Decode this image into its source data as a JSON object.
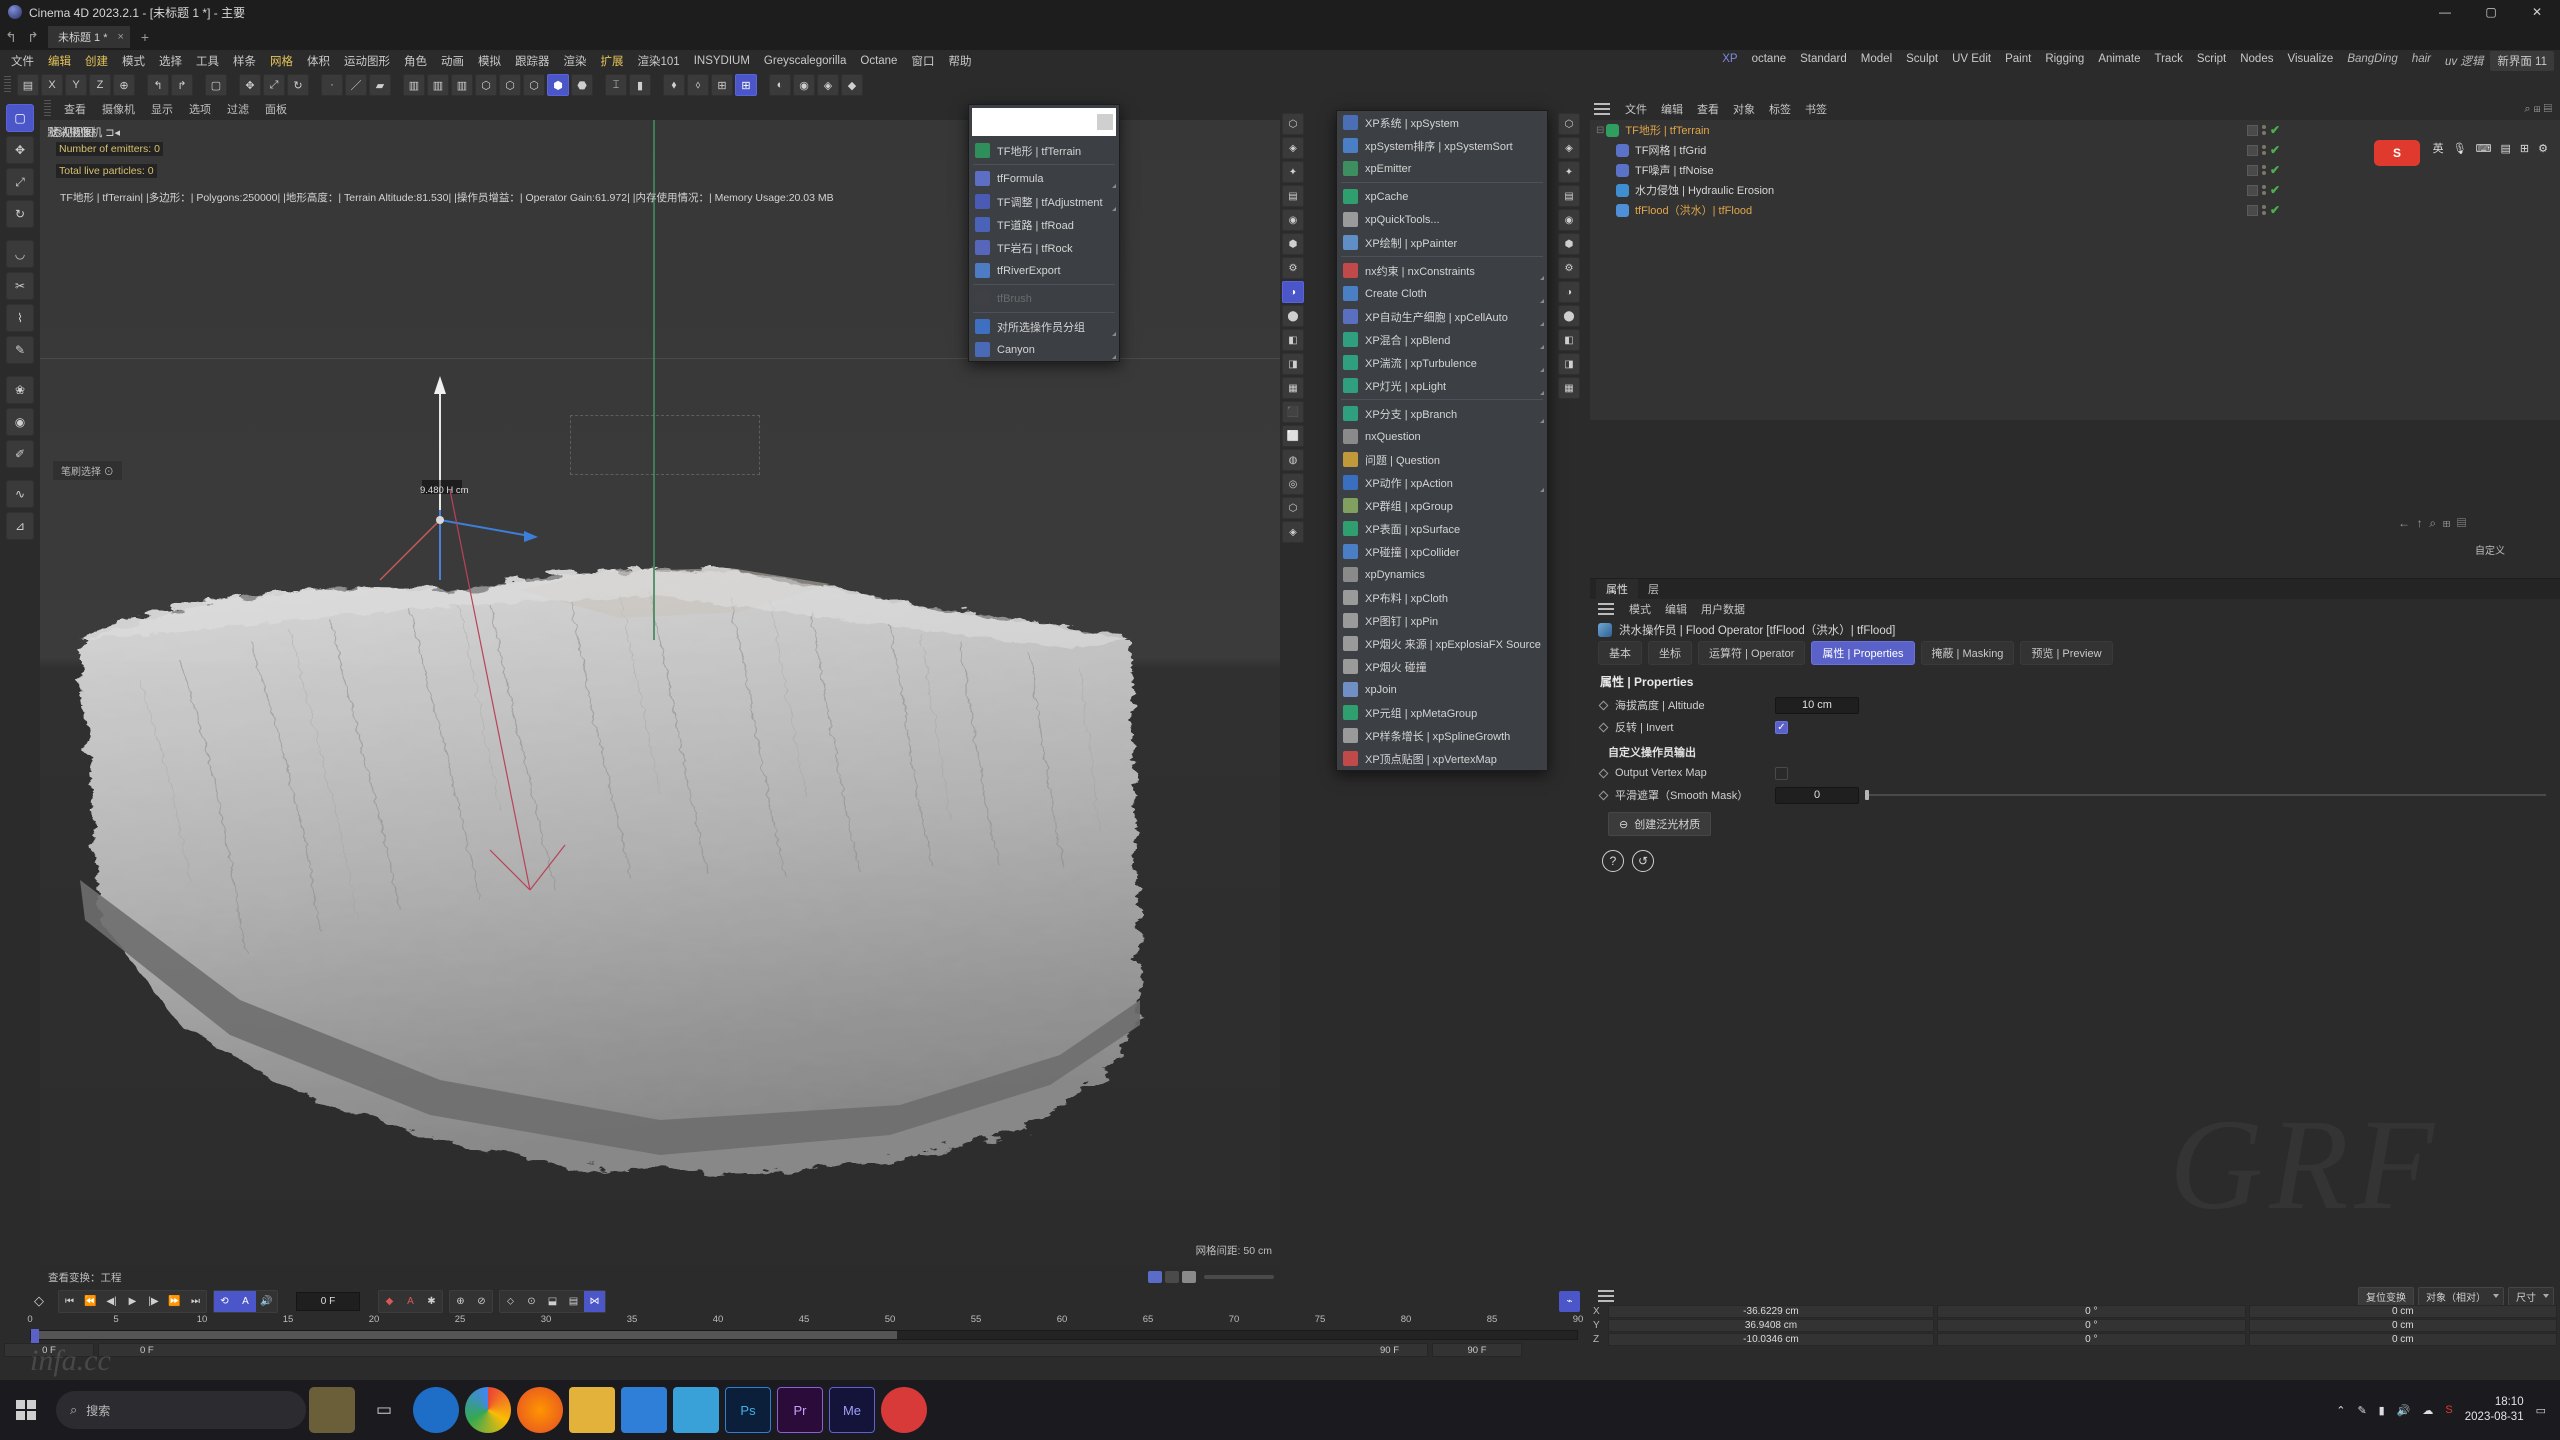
{
  "titlebar": {
    "title": "Cinema 4D 2023.2.1 - [未标题 1 *] - 主要",
    "minimize": "—",
    "maximize": "▢",
    "close": "✕"
  },
  "tabrow": {
    "undo": "↰",
    "redo": "↱",
    "doc_tab": "未标题 1 *",
    "close_tab": "×",
    "add_tab": "+"
  },
  "menubar": {
    "items": [
      "文件",
      "编辑",
      "创建",
      "模式",
      "选择",
      "工具",
      "样条",
      "网格",
      "体积",
      "运动图形",
      "角色",
      "动画",
      "模拟",
      "跟踪器",
      "渲染",
      "扩展",
      "渲染101",
      "INSYDIUM",
      "Greyscalegorilla",
      "Octane",
      "窗口",
      "帮助"
    ],
    "highlight": [
      "编辑",
      "创建",
      "网格",
      "扩展"
    ],
    "right_items": [
      "XP",
      "octane",
      "Standard",
      "Model",
      "Sculpt",
      "UV Edit",
      "Paint",
      "Rigging",
      "Animate",
      "Track",
      "Script",
      "Nodes",
      "Visualize",
      "BangDing",
      "hair",
      "uv 逻辑"
    ],
    "right_active": "XP",
    "right_italic": [
      "BangDing",
      "hair",
      "uv 逻辑"
    ],
    "new_layout": "新界面 11"
  },
  "toolbar": {
    "icons": [
      "grip",
      "move-lock",
      "x-axis",
      "y-axis",
      "z-axis",
      "world-coord",
      "sep",
      "undo-tool",
      "redo-tool",
      "sep",
      "live-select",
      "sep",
      "move",
      "scale",
      "rotate",
      "sep",
      "point-mode",
      "edge-mode",
      "poly-mode",
      "sep",
      "comb1",
      "comb2",
      "comb3",
      "snap1",
      "snap2",
      "snap3",
      "snap-on",
      "snap5",
      "sep",
      "workplane",
      "lock-wp",
      "sep",
      "deform1",
      "deform2",
      "quant1",
      "quant-on",
      "sep",
      "render1",
      "render2",
      "mat1",
      "mat2"
    ],
    "axis_labels": [
      "X",
      "Y",
      "Z"
    ]
  },
  "left_toolbar": {
    "items": [
      "live-selection-icon",
      "move-icon",
      "scale-icon",
      "rotate-icon",
      "sep",
      "magnet-icon",
      "knife-icon",
      "bridge-icon",
      "polygon-pen-icon",
      "sep",
      "brush-icon",
      "sculpt-icon",
      "paint-icon",
      "sep",
      "spline-pen-icon",
      "measure-icon"
    ]
  },
  "viewport": {
    "menu": [
      "查看",
      "摄像机",
      "显示",
      "选项",
      "过滤",
      "面板"
    ],
    "view_label": "透视视图",
    "camera_label": "默认摄像机",
    "emitters": "Number of emitters: 0",
    "particles": "Total live particles: 0",
    "statline": "TF地形 | tfTerrain| |多边形：| Polygons:250000| |地形高度：| Terrain Altitude:81.530| |操作员增益：| Operator Gain:61.972| |内存使用情况：| Memory Usage:20.03 MB",
    "brush_mode": "笔刷选择",
    "gizmo_label": "9.480 H cm",
    "grid_info": "网格间距: 50 cm",
    "footer_left": "查看变换：工程"
  },
  "dropdown_tf": {
    "search_placeholder": "",
    "items": [
      {
        "label": "TF地形 | tfTerrain",
        "color": "#2f8f5a",
        "sub": false,
        "disabled": false
      },
      {
        "label": "tfFormula",
        "color": "#5d6fc4",
        "sub": true,
        "disabled": false
      },
      {
        "label": "TF调整 | tfAdjustment",
        "color": "#4a5bb5",
        "sub": true,
        "disabled": false
      },
      {
        "label": "TF道路 | tfRoad",
        "color": "#4a62b8",
        "sub": false,
        "disabled": false
      },
      {
        "label": "TF岩石 | tfRock",
        "color": "#5566bb",
        "sub": false,
        "disabled": false
      },
      {
        "label": "tfRiverExport",
        "color": "#4d7cc4",
        "sub": false,
        "disabled": false
      },
      {
        "label": "tfBrush",
        "color": "#3e4044",
        "sub": false,
        "disabled": true
      },
      {
        "label": "对所选操作员分组",
        "color": "#3f6fc0",
        "sub": true,
        "disabled": false
      },
      {
        "label": "Canyon",
        "color": "#4a6ab8",
        "sub": true,
        "disabled": false
      }
    ]
  },
  "dropdown_xp": {
    "items": [
      {
        "label": "XP系统 | xpSystem",
        "color": "#4a6fb5",
        "sub": false,
        "sep_after": false
      },
      {
        "label": "xpSystem排序 | xpSystemSort",
        "color": "#4a7fc5",
        "sub": false,
        "sep_after": false
      },
      {
        "label": "xpEmitter",
        "color": "#3e8f5f",
        "sub": false,
        "sep_after": true
      },
      {
        "label": "xpCache",
        "color": "#2f9f6f",
        "sub": false,
        "sep_after": false
      },
      {
        "label": "xpQuickTools...",
        "color": "#9a9a9a",
        "sub": false,
        "sep_after": false
      },
      {
        "label": "XP绘制 | xpPainter",
        "color": "#5f8fc5",
        "sub": false,
        "sep_after": true
      },
      {
        "label": "nx约束 | nxConstraints",
        "color": "#c04a4a",
        "sub": true,
        "sep_after": false
      },
      {
        "label": "Create Cloth",
        "color": "#4a7fc5",
        "sub": true,
        "sep_after": false
      },
      {
        "label": "XP自动生产细胞 | xpCellAuto",
        "color": "#5a6fc0",
        "sub": true,
        "sep_after": false
      },
      {
        "label": "XP混合 | xpBlend",
        "color": "#2f9f7f",
        "sub": true,
        "sep_after": false
      },
      {
        "label": "XP湍流 | xpTurbulence",
        "color": "#2f9f7f",
        "sub": true,
        "sep_after": false
      },
      {
        "label": "XP灯光 | xpLight",
        "color": "#2f9f7f",
        "sub": true,
        "sep_after": true
      },
      {
        "label": "XP分支 | xpBranch",
        "color": "#2f9f7f",
        "sub": true,
        "sep_after": false
      },
      {
        "label": "nxQuestion",
        "color": "#8a8a8a",
        "sub": false,
        "sep_after": false
      },
      {
        "label": "问题 | Question",
        "color": "#c09a3a",
        "sub": false,
        "sep_after": false
      },
      {
        "label": "XP动作 | xpAction",
        "color": "#3a6fc0",
        "sub": true,
        "sep_after": false
      },
      {
        "label": "XP群组 | xpGroup",
        "color": "#7fa05f",
        "sub": false,
        "sep_after": false
      },
      {
        "label": "XP表面 | xpSurface",
        "color": "#2f9f6f",
        "sub": false,
        "sep_after": false
      },
      {
        "label": "XP碰撞 | xpCollider",
        "color": "#4a7fc5",
        "sub": false,
        "sep_after": false
      },
      {
        "label": "xpDynamics",
        "color": "#8a8a8a",
        "sub": false,
        "sep_after": false
      },
      {
        "label": "XP布料 | xpCloth",
        "color": "#9a9a9a",
        "sub": false,
        "sep_after": false
      },
      {
        "label": "XP图钉 | xpPin",
        "color": "#9a9a9a",
        "sub": false,
        "sep_after": false
      },
      {
        "label": "XP烟火 来源 | xpExplosiaFX Source",
        "color": "#9a9a9a",
        "sub": false,
        "sep_after": false
      },
      {
        "label": "XP烟火 碰撞",
        "color": "#9a9a9a",
        "sub": false,
        "sep_after": false
      },
      {
        "label": "xpJoin",
        "color": "#6f8fc5",
        "sub": false,
        "sep_after": false
      },
      {
        "label": "XP元组 | xpMetaGroup",
        "color": "#2f9f6f",
        "sub": false,
        "sep_after": false
      },
      {
        "label": "XP样条增长 | xpSplineGrowth",
        "color": "#9a9a9a",
        "sub": false,
        "sep_after": false
      },
      {
        "label": "XP顶点贴图 | xpVertexMap",
        "color": "#c04a4a",
        "sub": false,
        "sep_after": false
      }
    ]
  },
  "object_manager": {
    "menu": [
      "文件",
      "编辑",
      "查看",
      "对象",
      "标签",
      "书签"
    ],
    "rows": [
      {
        "label": "TF地形 | tfTerrain",
        "indent": 0,
        "selected": true,
        "color": "#2f9f5f",
        "expander": "⊟"
      },
      {
        "label": "TF网格 | tfGrid",
        "indent": 1,
        "selected": false,
        "color": "#5a72c8",
        "expander": ""
      },
      {
        "label": "TF噪声 | tfNoise",
        "indent": 1,
        "selected": false,
        "color": "#5a72c8",
        "expander": ""
      },
      {
        "label": "水力侵蚀 | Hydraulic Erosion",
        "indent": 1,
        "selected": false,
        "color": "#3f8fd0",
        "expander": ""
      },
      {
        "label": "tfFlood（洪水）| tfFlood",
        "indent": 1,
        "selected": true,
        "color": "#4f8fd8",
        "expander": ""
      }
    ]
  },
  "attributes": {
    "tabs": [
      "属性",
      "层"
    ],
    "active_tab": "属性",
    "menu": [
      "模式",
      "编辑",
      "用户数据"
    ],
    "object_title": "洪水操作员 | Flood Operator [tfFlood（洪水）| tfFlood]",
    "prop_tabs": [
      "基本",
      "坐标",
      "运算符 | Operator",
      "属性 | Properties",
      "掩蔽 | Masking",
      "预览 | Preview"
    ],
    "active_prop_tab": "属性 | Properties",
    "section_title": "属性 | Properties",
    "altitude_label": "海拔高度 | Altitude",
    "altitude_value": "10 cm",
    "invert_label": "反转 | Invert",
    "invert_checked": true,
    "custom_output_header": "自定义操作员输出",
    "output_vertex_label": "Output Vertex Map",
    "output_vertex_checked": false,
    "smooth_mask_label": "平滑遮罩（Smooth Mask）",
    "smooth_mask_value": "0",
    "create_material_btn": "创建泛光材质",
    "help_icon": "?",
    "reset_icon": "↺",
    "custom_label": "自定义"
  },
  "coordinates": {
    "reset_btn": "复位变换",
    "mode": "对象（相对）",
    "size_mode": "尺寸",
    "rows": [
      {
        "axis": "X",
        "pos": "-36.6229 cm",
        "rot": "0 °",
        "size": "0 cm"
      },
      {
        "axis": "Y",
        "pos": "36.9408 cm",
        "rot": "0 °",
        "size": "0 cm"
      },
      {
        "axis": "Z",
        "pos": "-10.0346 cm",
        "rot": "0 °",
        "size": "0 cm"
      }
    ]
  },
  "timeline": {
    "current_frame": "0 F",
    "start_frame": "0 F",
    "end_frame": "90 F",
    "preview_start": "0 F",
    "preview_end": "90 F",
    "ticks": [
      "0",
      "5",
      "10",
      "15",
      "20",
      "25",
      "30",
      "35",
      "40",
      "45",
      "50",
      "55",
      "60",
      "65",
      "70",
      "75",
      "80",
      "85",
      "90"
    ],
    "transport": [
      "⏮",
      "⏪",
      "◀|",
      "▶",
      "|▶",
      "⏩",
      "⏭"
    ],
    "controls": [
      "loop",
      "autokey",
      "sound",
      "keyframe-red",
      "autokey-red",
      "key-pos",
      "key-rot",
      "key-scale",
      "key-param",
      "key-pla",
      "key-anim",
      "key-obj",
      "key-mix"
    ]
  },
  "taskbar": {
    "search_placeholder": "搜索",
    "time": "18:10",
    "date": "2023-08-31",
    "apps": [
      "task-view",
      "edge",
      "chrome",
      "firefox",
      "folder",
      "mail",
      "store",
      "photoshop",
      "premiere",
      "media-encoder",
      "record"
    ]
  },
  "watermark": {
    "big": "GRF",
    "small": "infa.cc"
  },
  "ime": {
    "lang": "英",
    "items": [
      "mic-icon",
      "keyboard-icon",
      "panel-icon",
      "grid-icon",
      "gear-icon"
    ]
  },
  "colors": {
    "accent": "#4b56c8",
    "accent_light": "#5a62c9",
    "highlight_text": "#e5c45a",
    "selected_text": "#e0a54a",
    "check_green": "#4fae4f",
    "panel_bg": "#2b2b2b",
    "viewport_bg": "#383838"
  }
}
